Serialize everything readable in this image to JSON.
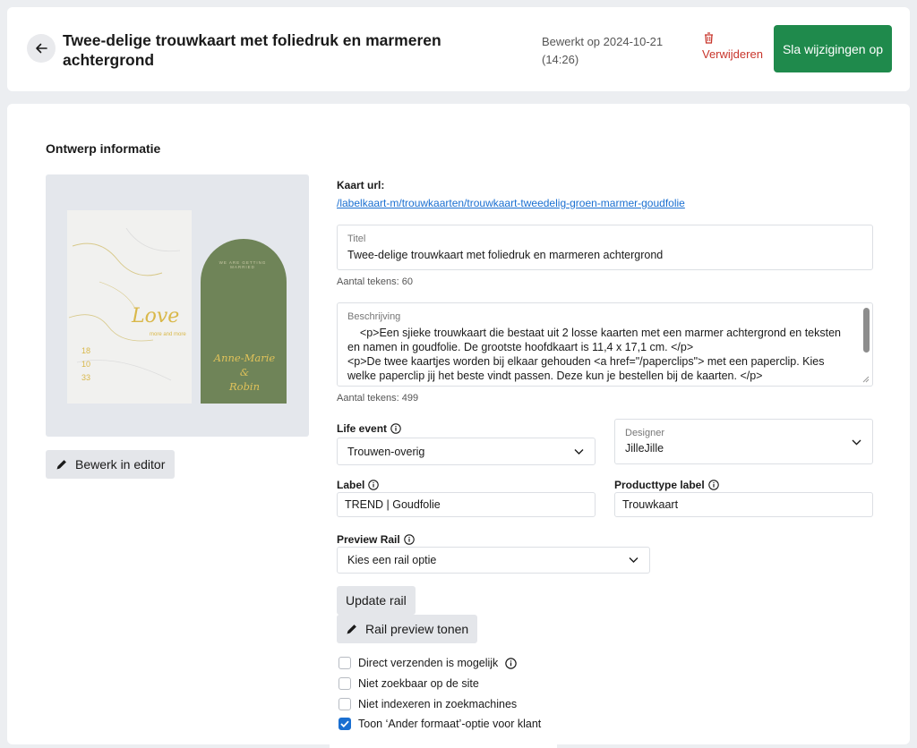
{
  "header": {
    "title": "Twee-delige trouwkaart met foliedruk en marmeren achtergrond",
    "edited": "Bewerkt op 2024-10-21 (14:26)",
    "delete_label": "Verwijderen",
    "save_label": "Sla wijzigingen op"
  },
  "section": {
    "title": "Ontwerp informatie",
    "edit_editor_label": "Bewerk in editor"
  },
  "preview": {
    "card_left_script": "Love",
    "card_left_small": "more and more",
    "card_left_date": [
      "18",
      "10",
      "33"
    ],
    "card_right_arc": "WE ARE GETTING MARRIED",
    "card_right_name1": "Anne-Marie",
    "card_right_amp": "&",
    "card_right_name2": "Robin"
  },
  "url": {
    "label": "Kaart url:",
    "value": "/labelkaart-m/trouwkaarten/trouwkaart-tweedelig-groen-marmer-goudfolie"
  },
  "title_field": {
    "label": "Titel",
    "value": "Twee-delige trouwkaart met foliedruk en marmeren achtergrond",
    "counter": "Aantal tekens: 60"
  },
  "description": {
    "label": "Beschrijving",
    "value": "    <p>Een sjieke trouwkaart die bestaat uit 2 losse kaarten met een marmer achtergrond en teksten en namen in goudfolie. De grootste hoofdkaart is 11,4 x 17,1 cm. </p>\n<p>De twee kaartjes worden bij elkaar gehouden <a href=\"/paperclips\"> met een paperclip. Kies welke paperclip jij het beste vindt passen. Deze kun je bestellen bij de kaarten. </p>\n<p>Dit product maakt onderdeel uit van <a id=\"complete-set-link-trouwen\" href=\"/papeterie-trouwen?",
    "counter": "Aantal tekens: 499"
  },
  "life_event": {
    "label": "Life event",
    "value": "Trouwen-overig"
  },
  "designer": {
    "label": "Designer",
    "value": "JilleJille"
  },
  "label_field": {
    "label": "Label",
    "value": "TREND | Goudfolie"
  },
  "producttype": {
    "label": "Producttype label",
    "value": "Trouwkaart"
  },
  "preview_rail": {
    "label": "Preview Rail",
    "value": "Kies een rail optie",
    "update_label": "Update rail",
    "show_label": "Rail preview tonen"
  },
  "checkboxes": [
    {
      "label": "Direct verzenden is mogelijk",
      "checked": false
    },
    {
      "label": "Niet zoekbaar op de site",
      "checked": false
    },
    {
      "label": "Niet indexeren in zoekmachines",
      "checked": false
    },
    {
      "label": "Toon ‘Ander formaat’-optie voor klant",
      "checked": true
    }
  ],
  "colors": {
    "accent_green": "#1f8a4c",
    "danger_red": "#c8352b",
    "link_blue": "#1a6fd1",
    "card_green": "#6f8458",
    "gold": "#d9b84a"
  }
}
